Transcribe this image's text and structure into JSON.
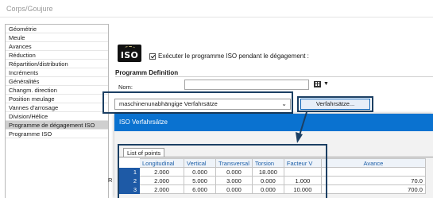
{
  "window": {
    "title": "Corps/Goujure"
  },
  "sidebar": {
    "items": [
      {
        "label": "Géométrie"
      },
      {
        "label": "Meule"
      },
      {
        "label": "Avances"
      },
      {
        "label": "Réduction"
      },
      {
        "label": "Répartition/distribution"
      },
      {
        "label": "Incréments"
      },
      {
        "label": "Généralités"
      },
      {
        "label": "Changm. direction"
      },
      {
        "label": "Position meulage"
      },
      {
        "label": "Vannes d'arrosage"
      },
      {
        "label": "Division/Hélice"
      },
      {
        "label": "Programme de dégagement ISO"
      },
      {
        "label": "Programme ISO"
      }
    ],
    "selected": "Programme de dégagement ISO"
  },
  "main": {
    "logo_text": "ISO",
    "execute_checkbox_label": "Exécuter le programme ISO pendant le dégagement :",
    "execute_checked": true,
    "section_title": "Programm Definition",
    "nom_label": "Nom:",
    "nom_value": "",
    "combo_value": "maschinenunabhängige Verfahrsätze",
    "verfahrsatze_button": "Verfahrsätze...",
    "r_label": "R"
  },
  "subwindow": {
    "title": "ISO Verfahrsätze",
    "tab_label": "List of points",
    "columns": [
      "Longitudinal",
      "Vertical",
      "Transversal",
      "Torsion",
      "Facteur V",
      "Avance"
    ],
    "rows": [
      {
        "index": "1",
        "longitudinal": "2.000",
        "vertical": "0.000",
        "transversal": "0.000",
        "torsion": "18.000",
        "facteur_v": "",
        "avance": ""
      },
      {
        "index": "2",
        "longitudinal": "2.000",
        "vertical": "5.000",
        "transversal": "3.000",
        "torsion": "0.000",
        "facteur_v": "1.000",
        "avance": "70.0"
      },
      {
        "index": "3",
        "longitudinal": "2.000",
        "vertical": "6.000",
        "transversal": "0.000",
        "torsion": "0.000",
        "facteur_v": "10.000",
        "avance": "700.0"
      }
    ]
  },
  "colors": {
    "titlebar_blue": "#0a72d0",
    "highlight_border": "#1b3f63",
    "selected_nav": "#cfcfcf",
    "index_cell": "#1e5aa6"
  }
}
